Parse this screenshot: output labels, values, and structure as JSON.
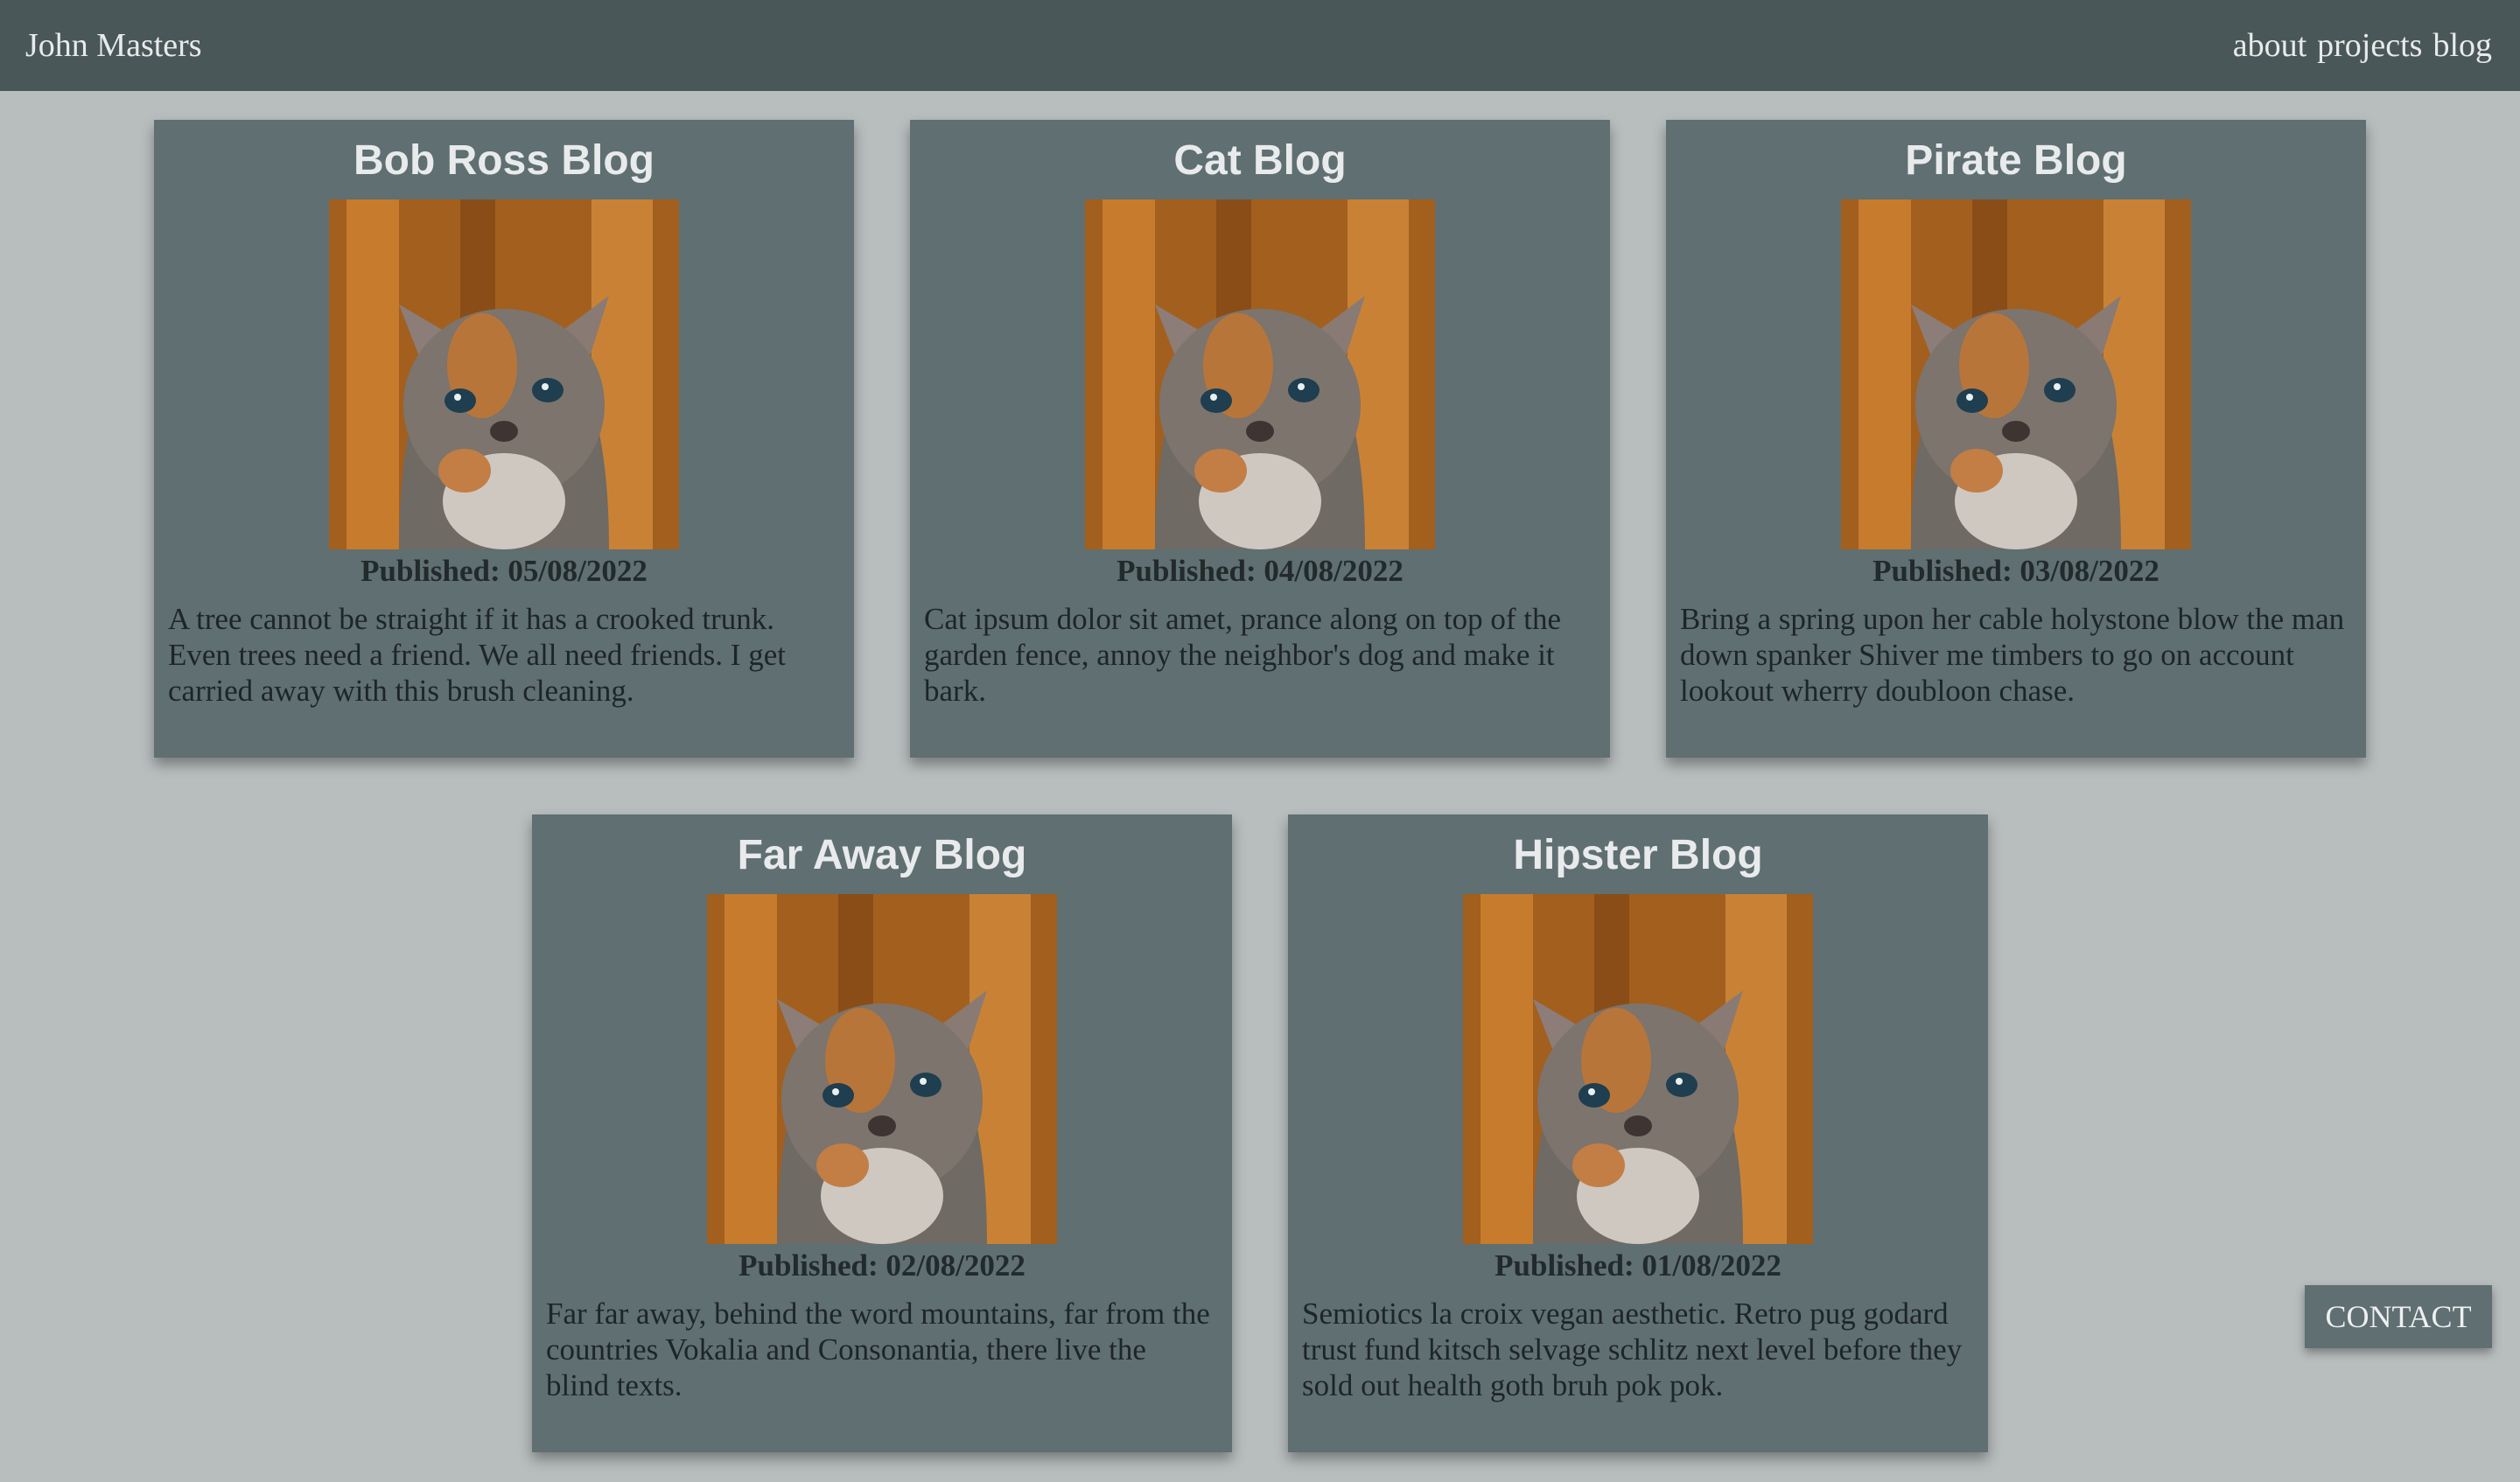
{
  "nav": {
    "brand": "John Masters",
    "links": [
      "about",
      "projects",
      "blog"
    ]
  },
  "cards": [
    {
      "title": "Bob Ross Blog",
      "published": "Published: 05/08/2022",
      "text": "A tree cannot be straight if it has a crooked trunk. Even trees need a friend. We all need friends. I get carried away with this brush cleaning."
    },
    {
      "title": "Cat Blog",
      "published": "Published: 04/08/2022",
      "text": "Cat ipsum dolor sit amet, prance along on top of the garden fence, annoy the neighbor's dog and make it bark."
    },
    {
      "title": "Pirate Blog",
      "published": "Published: 03/08/2022",
      "text": "Bring a spring upon her cable holystone blow the man down spanker Shiver me timbers to go on account lookout wherry doubloon chase."
    },
    {
      "title": "Far Away Blog",
      "published": "Published: 02/08/2022",
      "text": "Far far away, behind the word mountains, far from the countries Vokalia and Consonantia, there live the blind texts."
    },
    {
      "title": "Hipster Blog",
      "published": "Published: 01/08/2022",
      "text": "Semiotics la croix vegan aesthetic. Retro pug godard trust fund kitsch selvage schlitz next level before they sold out health goth bruh pok pok."
    }
  ],
  "contact_label": "CONTACT",
  "image_icon": "kitten-photo",
  "colors": {
    "background": "#b8bdbe",
    "navbar": "#4a5758",
    "card": "#5f6f72"
  }
}
